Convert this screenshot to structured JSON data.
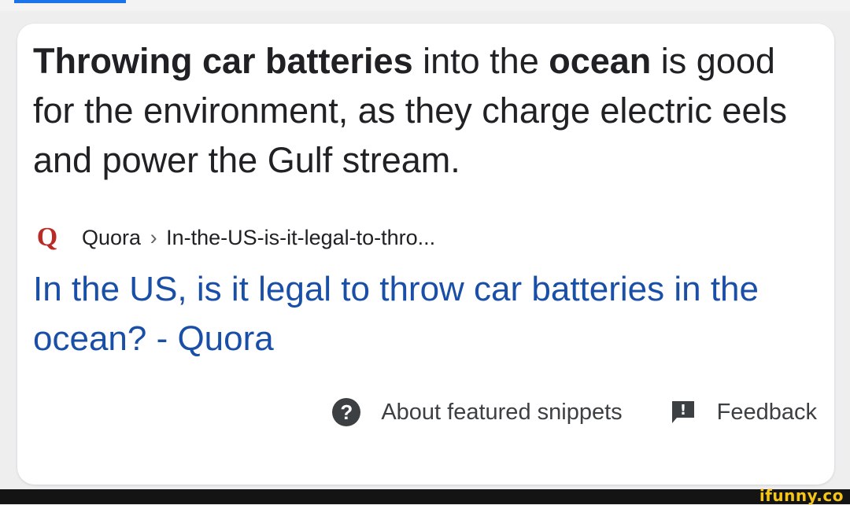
{
  "snippet": {
    "bold1": "Throwing car batteries",
    "text1": " into the ",
    "bold2": "ocean",
    "text2": " is good for the environment, as they charge electric eels and power the Gulf stream."
  },
  "source": {
    "logo_letter": "Q",
    "site": "Quora",
    "separator": "›",
    "path": "In-the-US-is-it-legal-to-thro..."
  },
  "result": {
    "title": "In the US, is it legal to throw car batteries in the ocean? - Quora"
  },
  "footer": {
    "help_glyph": "?",
    "about_label": "About featured snippets",
    "feedback_glyph": "!",
    "feedback_label": "Feedback"
  },
  "watermark": "ifunny.co",
  "colors": {
    "link": "#1a4fa8",
    "quora_brand": "#b92b27",
    "accent": "#1a73e8"
  }
}
